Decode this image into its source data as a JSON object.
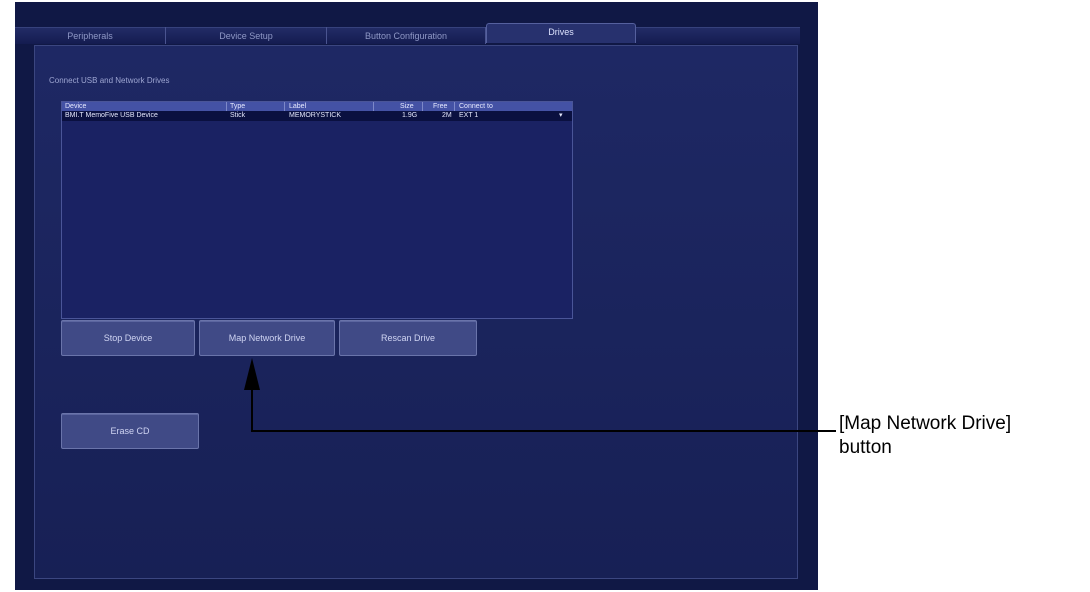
{
  "tabs": [
    {
      "label": "Peripherals",
      "active": false
    },
    {
      "label": "Device Setup",
      "active": false
    },
    {
      "label": "Button Configuration",
      "active": false
    },
    {
      "label": "Drives",
      "active": true
    }
  ],
  "section_label": "Connect USB and Network Drives",
  "table": {
    "columns": [
      "Device",
      "Type",
      "Label",
      "Size",
      "Free",
      "Connect to"
    ],
    "rows": [
      {
        "device": "BMI.T MemoFive USB Device",
        "type": "Stick",
        "label": "MEMORYSTICK",
        "size": "1.9G",
        "free": "2M",
        "connect_to": "EXT 1"
      }
    ]
  },
  "buttons": {
    "stop_device": "Stop Device",
    "map_network_drive": "Map Network Drive",
    "rescan_drive": "Rescan Drive",
    "erase_cd": "Erase CD"
  },
  "annotation": {
    "line1": "[Map Network Drive]",
    "line2": "button"
  },
  "colors": {
    "background": "#101845",
    "panel": "#1c2560",
    "table_header": "#4452a5",
    "button": "#404a86"
  }
}
